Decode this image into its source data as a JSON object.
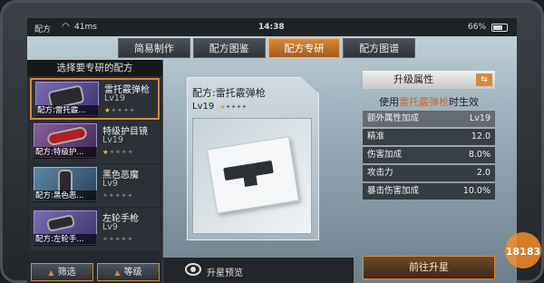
{
  "status": {
    "carrier": "配方",
    "ping": "41ms",
    "time": "14:38",
    "battery": "66%"
  },
  "tabs": [
    {
      "label": "简易制作",
      "active": false
    },
    {
      "label": "配方图鉴",
      "active": false
    },
    {
      "label": "配方专研",
      "active": true
    },
    {
      "label": "配方图谱",
      "active": false
    }
  ],
  "left_panel": {
    "title": "选择要专研的配方",
    "recipes": [
      {
        "name": "雷托霰弹枪",
        "level": "Lv19",
        "caption": "配方:雷托霰...",
        "stars_on": 1,
        "stars_total": 5,
        "selected": true
      },
      {
        "name": "特级护目镜",
        "level": "Lv19",
        "caption": "配方:特级护...",
        "stars_on": 1,
        "stars_total": 5,
        "selected": false
      },
      {
        "name": "黑色恶魔",
        "level": "Lv9",
        "caption": "配方:黑色恶...",
        "stars_on": 0,
        "stars_total": 5,
        "selected": false
      },
      {
        "name": "左轮手枪",
        "level": "Lv9",
        "caption": "配方:左轮手...",
        "stars_on": 0,
        "stars_total": 5,
        "selected": false
      }
    ],
    "filter_label": "筛选",
    "level_label": "等级"
  },
  "card": {
    "title": "配方:雷托霰弹枪",
    "level": "Lv19",
    "stars_on": 1,
    "stars_total": 5
  },
  "attributes": {
    "header": "升级属性",
    "sub_prefix": "使用",
    "sub_weapon": "雷托霰弹枪",
    "sub_suffix": "时生效",
    "head_label": "额外属性加成",
    "head_value": "Lv19",
    "rows": [
      {
        "label": "精准",
        "value": "12.0"
      },
      {
        "label": "伤害加成",
        "value": "8.0%"
      },
      {
        "label": "攻击力",
        "value": "2.0"
      },
      {
        "label": "暴击伤害加成",
        "value": "10.0%"
      }
    ]
  },
  "bottom": {
    "preview_label": "升星预览",
    "upgrade_label": "前往升星"
  },
  "watermark": "18183",
  "colors": {
    "accent": "#d58a3b",
    "weapon_text": "#d96418",
    "star_on": "#f2b640"
  }
}
